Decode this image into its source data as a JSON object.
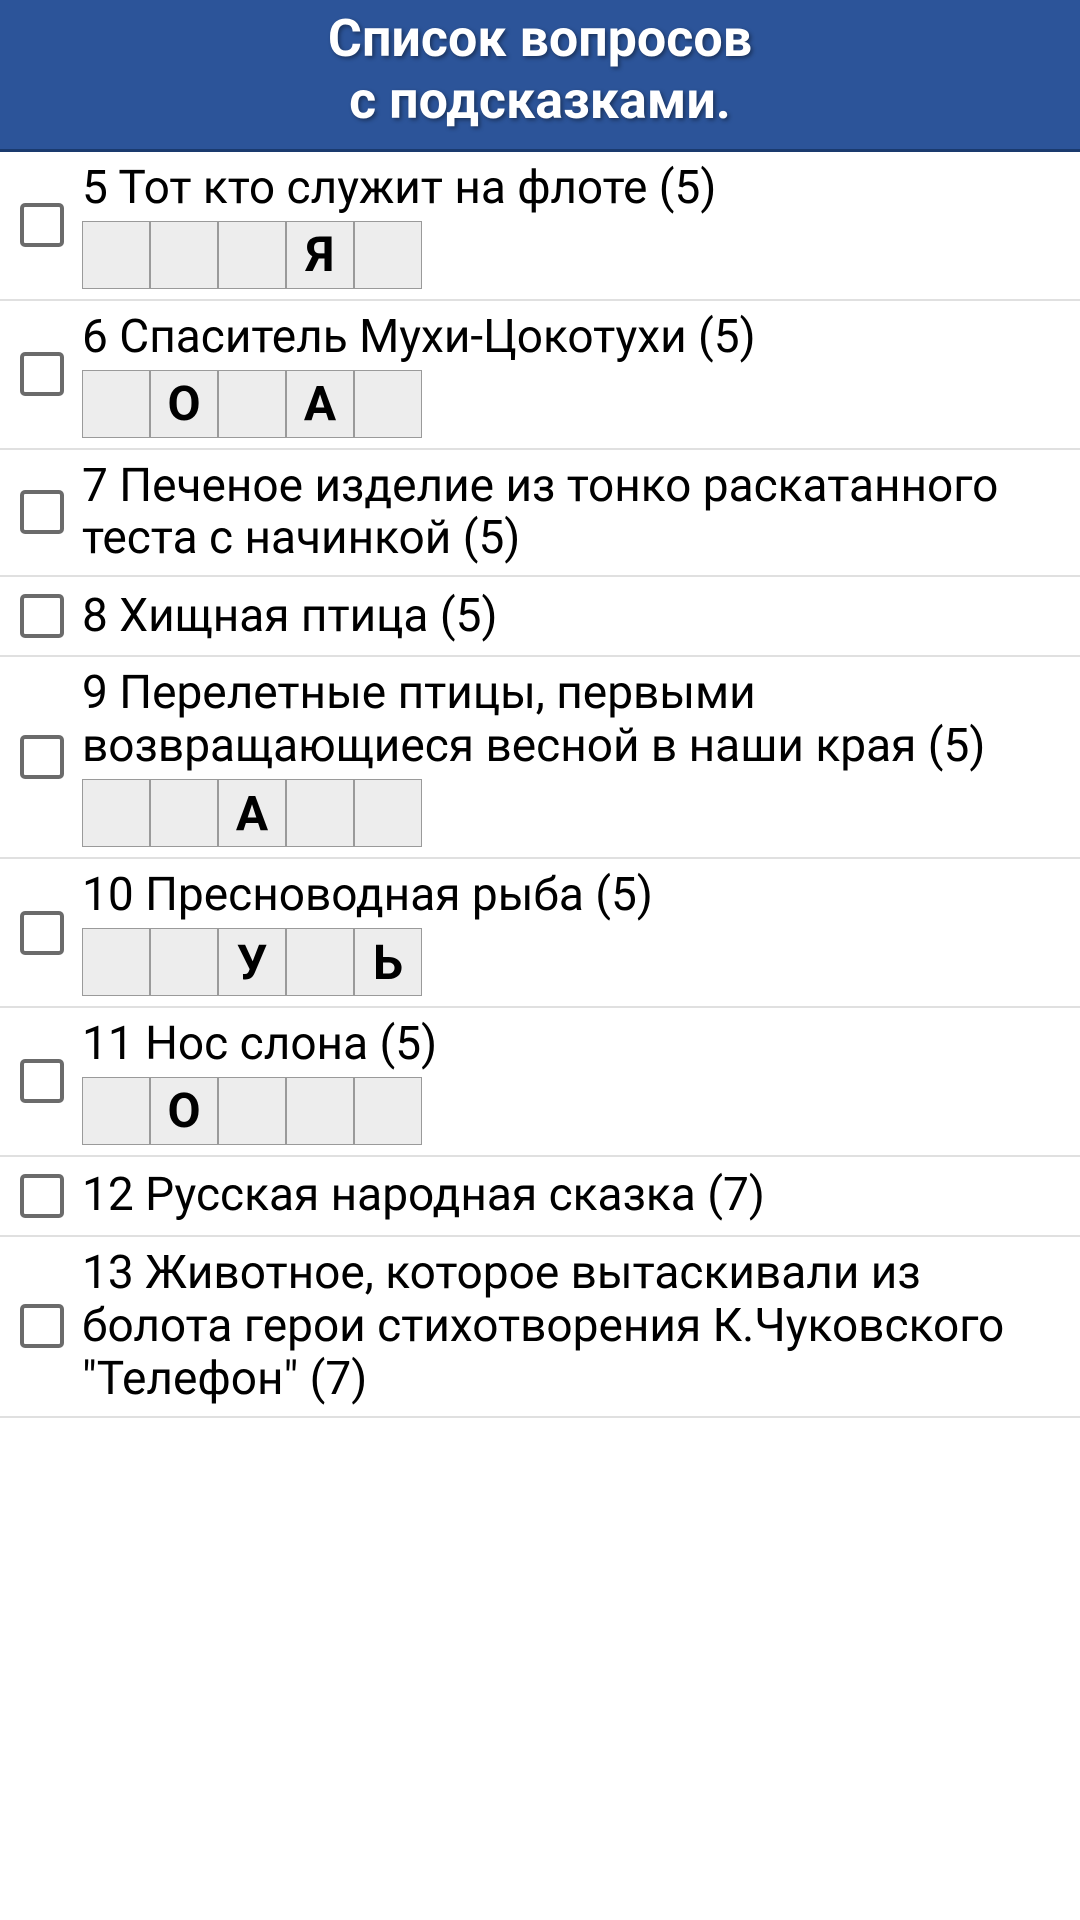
{
  "header": {
    "title_line1": "Список вопросов",
    "title_line2": "с подсказками."
  },
  "questions": [
    {
      "number": 5,
      "text": "Тот кто служит на флоте",
      "length": 5,
      "letters": [
        "",
        "",
        "",
        "Я",
        ""
      ],
      "show_grid": true
    },
    {
      "number": 6,
      "text": "Спаситель Мухи-Цокотухи",
      "length": 5,
      "letters": [
        "",
        "О",
        "",
        "А",
        ""
      ],
      "show_grid": true
    },
    {
      "number": 7,
      "text": "Печеное изделие из тонко раскатанного теста с начинкой",
      "length": 5,
      "letters": [],
      "show_grid": false
    },
    {
      "number": 8,
      "text": "Хищная птица",
      "length": 5,
      "letters": [],
      "show_grid": false
    },
    {
      "number": 9,
      "text": "Перелетные птицы, первыми возвращающиеся весной в наши края",
      "length": 5,
      "letters": [
        "",
        "",
        "А",
        "",
        ""
      ],
      "show_grid": true
    },
    {
      "number": 10,
      "text": "Пресноводная рыба",
      "length": 5,
      "letters": [
        "",
        "",
        "У",
        "",
        "Ь"
      ],
      "show_grid": true
    },
    {
      "number": 11,
      "text": "Нос слона",
      "length": 5,
      "letters": [
        "",
        "О",
        "",
        "",
        ""
      ],
      "show_grid": true
    },
    {
      "number": 12,
      "text": "Русская народная сказка",
      "length": 7,
      "letters": [],
      "show_grid": false
    },
    {
      "number": 13,
      "text": "Животное, которое вытаскивали из болота герои стихотворения К.Чуковского \"Телефон\"",
      "length": 7,
      "letters": [],
      "show_grid": false
    }
  ]
}
